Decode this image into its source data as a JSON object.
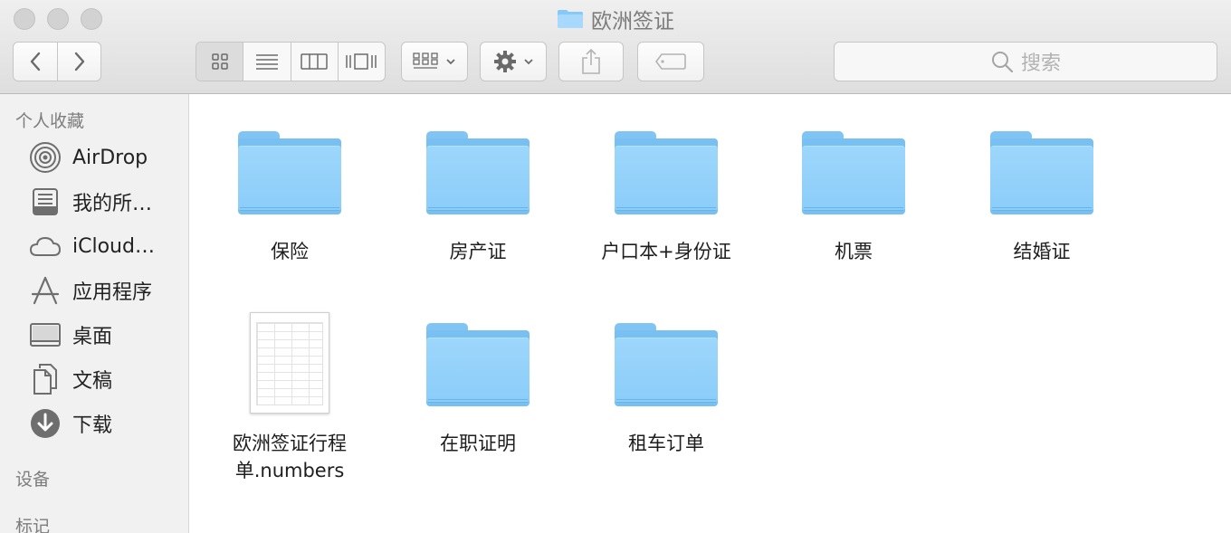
{
  "window": {
    "title": "欧洲签证",
    "traffic_lights": [
      "close",
      "minimize",
      "zoom"
    ]
  },
  "toolbar": {
    "back_icon": "chevron-left-icon",
    "forward_icon": "chevron-right-icon",
    "view_modes": [
      "icon-view",
      "list-view",
      "column-view",
      "cover-flow-view"
    ],
    "active_view": "icon-view",
    "arrange_icon": "arrange-grid-icon",
    "action_icon": "gear-icon",
    "share_icon": "share-icon",
    "tag_icon": "tag-icon",
    "search_placeholder": "搜索"
  },
  "sidebar": {
    "favorites_header": "个人收藏",
    "items": [
      {
        "label": "AirDrop",
        "icon": "airdrop-icon"
      },
      {
        "label": "我的所…",
        "icon": "all-files-icon"
      },
      {
        "label": "iCloud…",
        "icon": "cloud-icon"
      },
      {
        "label": "应用程序",
        "icon": "applications-icon"
      },
      {
        "label": "桌面",
        "icon": "desktop-icon"
      },
      {
        "label": "文稿",
        "icon": "documents-icon"
      },
      {
        "label": "下载",
        "icon": "download-icon"
      }
    ],
    "devices_header": "设备",
    "tags_header": "标记"
  },
  "files": [
    {
      "name": "保险",
      "kind": "folder"
    },
    {
      "name": "房产证",
      "kind": "folder"
    },
    {
      "name": "户口本+身份证",
      "kind": "folder"
    },
    {
      "name": "机票",
      "kind": "folder"
    },
    {
      "name": "结婚证",
      "kind": "folder"
    },
    {
      "name": "欧洲签证行程单.numbers",
      "kind": "numbers-document"
    },
    {
      "name": "在职证明",
      "kind": "folder"
    },
    {
      "name": "租车订单",
      "kind": "folder"
    }
  ],
  "colors": {
    "folder_blue": "#8bcdfa",
    "folder_dark": "#78c0f1",
    "sidebar_bg": "#f1f1f1",
    "toolbar_bg": "#e6e6e6"
  }
}
